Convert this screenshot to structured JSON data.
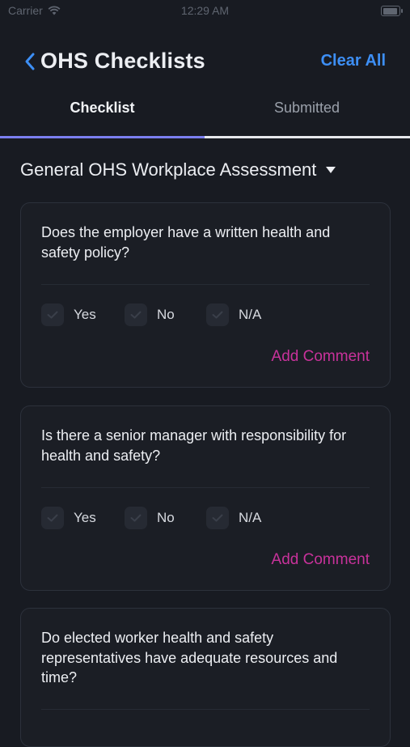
{
  "status_bar": {
    "carrier": "Carrier",
    "time": "12:29 AM"
  },
  "header": {
    "back_icon": "chevron-left-icon",
    "title": "OHS Checklists",
    "clear_all": "Clear All"
  },
  "tabs": [
    {
      "label": "Checklist",
      "active": true
    },
    {
      "label": "Submitted",
      "active": false
    }
  ],
  "section": {
    "title": "General OHS Workplace Assessment",
    "icon": "caret-down-icon"
  },
  "checklist": [
    {
      "question": "Does the employer have a written health and safety policy?",
      "options": [
        "Yes",
        "No",
        "N/A"
      ],
      "add_comment": "Add Comment"
    },
    {
      "question": "Is there a senior manager with responsibility for health and safety?",
      "options": [
        "Yes",
        "No",
        "N/A"
      ],
      "add_comment": "Add Comment"
    },
    {
      "question": "Do elected worker health and safety representatives have adequate resources and time?"
    }
  ],
  "colors": {
    "background": "#181b22",
    "card": "#1b1e25",
    "accent_blue": "#3d8ff5",
    "accent_pink": "#c8329b",
    "tab_indicator": "#7b7ff0"
  }
}
